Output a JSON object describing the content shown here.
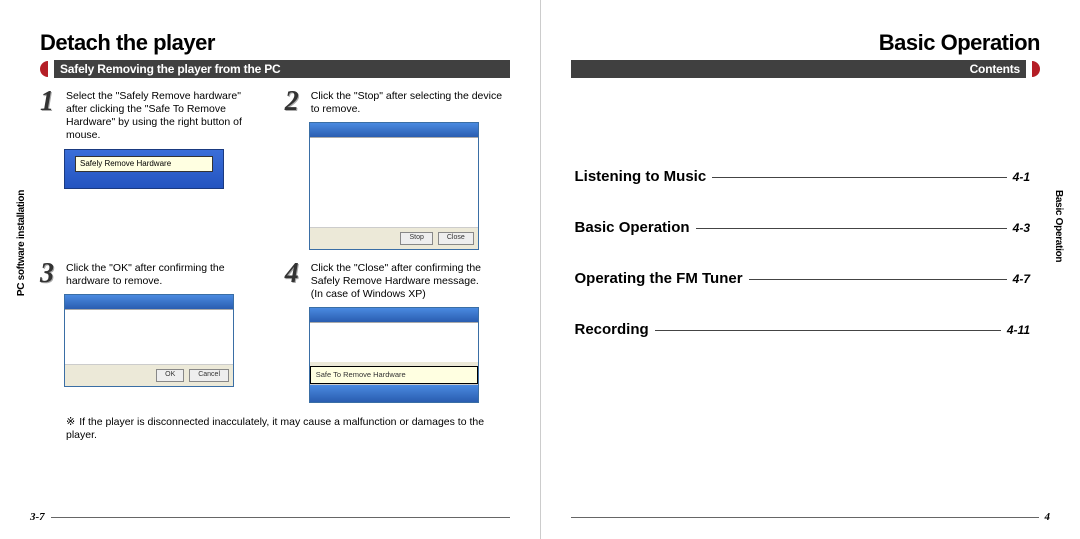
{
  "left": {
    "title": "Detach the player",
    "subhead": "Safely Removing the player from the PC",
    "side_tab": "PC software installation",
    "page_number": "3-7",
    "steps": [
      {
        "n": "1",
        "text": "Select the \"Safely Remove hardware\" after clicking the \"Safe To Remove Hardware\" by using the right button of mouse.",
        "tray_tip": "Safely Remove Hardware"
      },
      {
        "n": "2",
        "text": "Click the \"Stop\" after selecting the device to remove."
      },
      {
        "n": "3",
        "text": "Click the \"OK\" after confirming the hardware to remove."
      },
      {
        "n": "4",
        "text": "Click the \"Close\" after confirming the Safely Remove Hardware message.\n(In case of Windows XP)"
      }
    ],
    "note": "If the player is disconnected inacculately, it may cause a malfunction or damages to the player.",
    "note_mark": "※"
  },
  "right": {
    "title": "Basic Operation",
    "subhead": "Contents",
    "side_tab": "Basic Operation",
    "page_number": "4",
    "toc": [
      {
        "label": "Listening to Music",
        "page": "4-1"
      },
      {
        "label": "Basic Operation",
        "page": "4-3"
      },
      {
        "label": "Operating the FM Tuner",
        "page": "4-7"
      },
      {
        "label": "Recording",
        "page": "4-11"
      }
    ]
  }
}
